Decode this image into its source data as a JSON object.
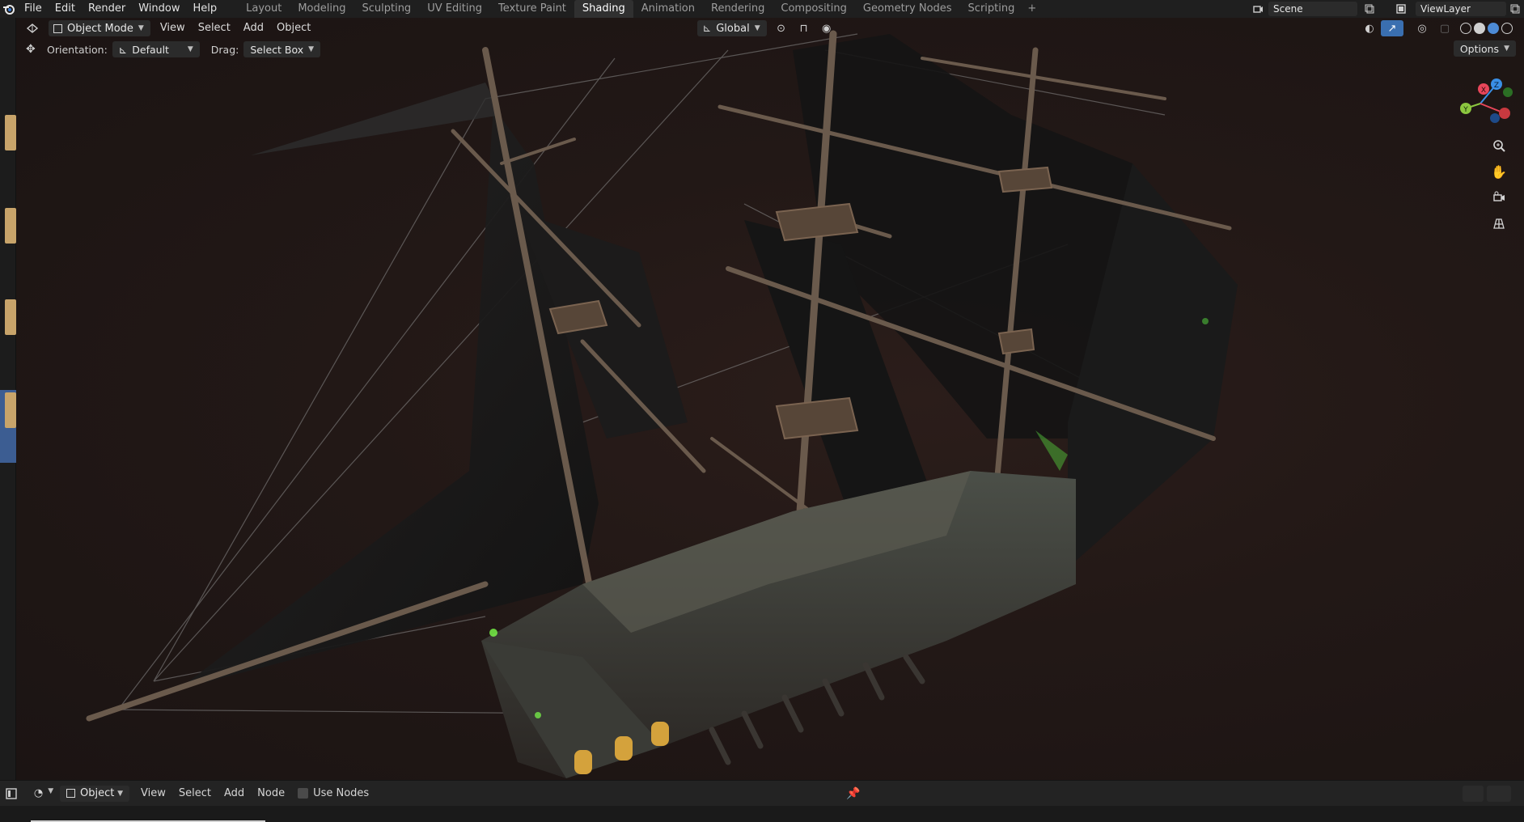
{
  "topbar": {
    "menus": [
      "File",
      "Edit",
      "Render",
      "Window",
      "Help"
    ],
    "workspaces": [
      "Layout",
      "Modeling",
      "Sculpting",
      "UV Editing",
      "Texture Paint",
      "Shading",
      "Animation",
      "Rendering",
      "Compositing",
      "Geometry Nodes",
      "Scripting"
    ],
    "active_workspace": "Shading",
    "add_workspace": "+",
    "scene": "Scene",
    "view_layer": "ViewLayer"
  },
  "viewport": {
    "mode": "Object Mode",
    "menus": [
      "View",
      "Select",
      "Add",
      "Object"
    ],
    "orientation_label": "Orientation:",
    "orientation_value": "Default",
    "drag_label": "Drag:",
    "drag_value": "Select Box",
    "transform_orientation": "Global",
    "options": "Options",
    "gizmo_axes": {
      "x": "X",
      "y": "Y",
      "z": "Z"
    },
    "colors": {
      "x": "#e8465a",
      "y": "#8cc63f",
      "z": "#3a8fe6",
      "bg": "#221816"
    }
  },
  "node_editor": {
    "mode": "Object",
    "menus": [
      "View",
      "Select",
      "Add",
      "Node"
    ],
    "use_nodes_label": "Use Nodes"
  },
  "icons": [
    "blender-logo-icon",
    "editor-type-icon",
    "object-mode-icon",
    "move-tool-icon",
    "gizmo-icon",
    "zoom-icon",
    "hand-pan-icon",
    "camera-icon",
    "grid-icon",
    "pin-icon",
    "shading-icon"
  ]
}
